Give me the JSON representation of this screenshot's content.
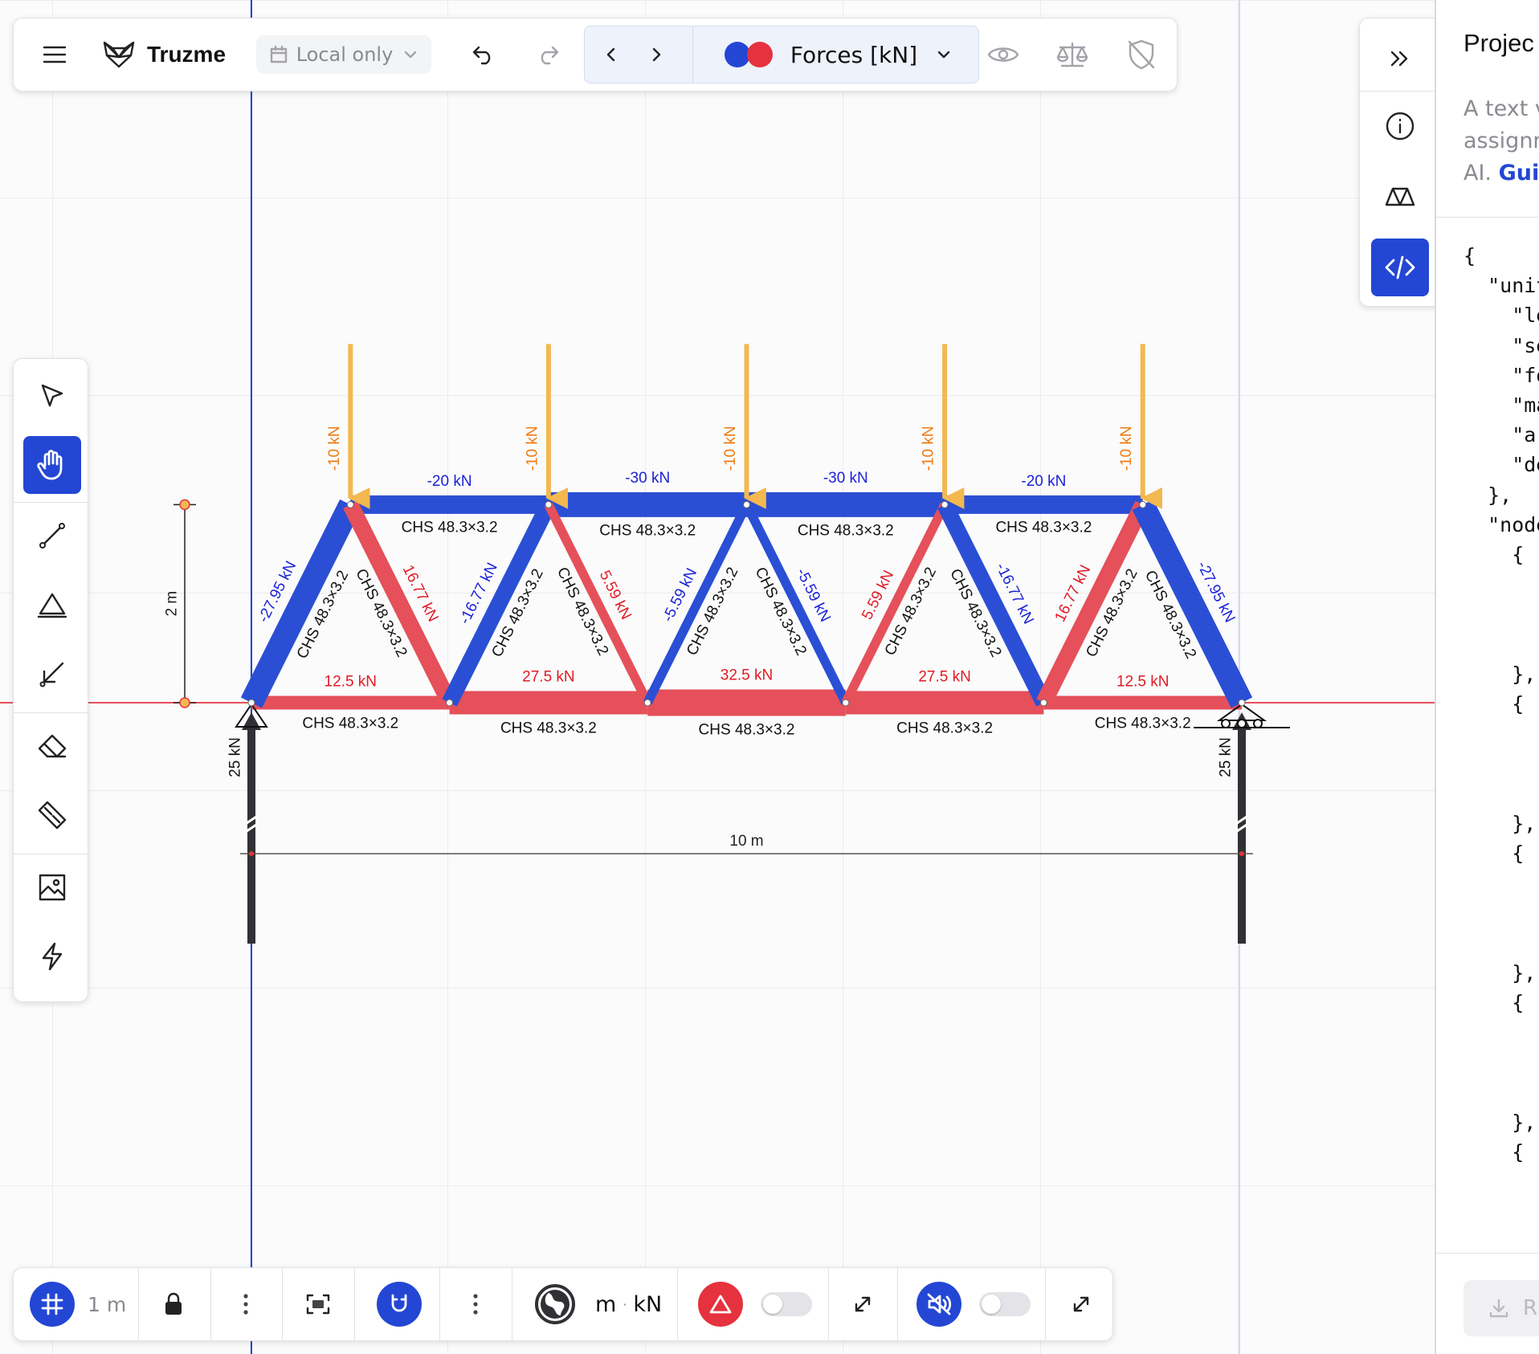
{
  "app": {
    "name": "Truzme",
    "storage_label": "Local only",
    "result_label": "Forces [kN]"
  },
  "colors": {
    "accent": "#2347d4",
    "tension": "#e5505a",
    "compression": "#2b4fd4",
    "load": "#f3b84f",
    "reaction": "#2f3135",
    "load_text": "#f07a10",
    "tension_text": "#e01b24",
    "compression_text": "#1c22d6"
  },
  "bottom_toolbar": {
    "grid_size": "1 m",
    "units_length": "m",
    "units_separator": "·",
    "units_force": "kN"
  },
  "truss": {
    "nodes": [
      {
        "id": "n1",
        "x": 0,
        "y": 0
      },
      {
        "id": "n2",
        "x": 2,
        "y": 0
      },
      {
        "id": "n3",
        "x": 4,
        "y": 0
      },
      {
        "id": "n4",
        "x": 6,
        "y": 0
      },
      {
        "id": "n5",
        "x": 8,
        "y": 0
      },
      {
        "id": "n6",
        "x": 10,
        "y": 0
      },
      {
        "id": "n7",
        "x": 1,
        "y": 2
      },
      {
        "id": "n8",
        "x": 3,
        "y": 2
      },
      {
        "id": "n9",
        "x": 5,
        "y": 2
      },
      {
        "id": "n10",
        "x": 7,
        "y": 2
      },
      {
        "id": "n11",
        "x": 9,
        "y": 2
      }
    ],
    "members": [
      {
        "from": "n1",
        "to": "n2",
        "force": 12.5,
        "label": "12.5 kN",
        "section": "CHS 48.3×3.2"
      },
      {
        "from": "n2",
        "to": "n3",
        "force": 27.5,
        "label": "27.5 kN",
        "section": "CHS 48.3×3.2"
      },
      {
        "from": "n3",
        "to": "n4",
        "force": 32.5,
        "label": "32.5 kN",
        "section": "CHS 48.3×3.2"
      },
      {
        "from": "n4",
        "to": "n5",
        "force": 27.5,
        "label": "27.5 kN",
        "section": "CHS 48.3×3.2"
      },
      {
        "from": "n5",
        "to": "n6",
        "force": 12.5,
        "label": "12.5 kN",
        "section": "CHS 48.3×3.2"
      },
      {
        "from": "n7",
        "to": "n8",
        "force": -20,
        "label": "-20 kN",
        "section": "CHS 48.3×3.2"
      },
      {
        "from": "n8",
        "to": "n9",
        "force": -30,
        "label": "-30 kN",
        "section": "CHS 48.3×3.2"
      },
      {
        "from": "n9",
        "to": "n10",
        "force": -30,
        "label": "-30 kN",
        "section": "CHS 48.3×3.2"
      },
      {
        "from": "n10",
        "to": "n11",
        "force": -20,
        "label": "-20 kN",
        "section": "CHS 48.3×3.2"
      },
      {
        "from": "n1",
        "to": "n7",
        "force": -27.95,
        "label": "-27.95 kN",
        "section": "CHS 48.3×3.2"
      },
      {
        "from": "n7",
        "to": "n2",
        "force": 16.77,
        "label": "16.77 kN",
        "section": "CHS 48.3×3.2"
      },
      {
        "from": "n2",
        "to": "n8",
        "force": -16.77,
        "label": "-16.77 kN",
        "section": "CHS 48.3×3.2"
      },
      {
        "from": "n8",
        "to": "n3",
        "force": 5.59,
        "label": "5.59 kN",
        "section": "CHS 48.3×3.2"
      },
      {
        "from": "n3",
        "to": "n9",
        "force": -5.59,
        "label": "-5.59 kN",
        "section": "CHS 48.3×3.2"
      },
      {
        "from": "n9",
        "to": "n4",
        "force": -5.59,
        "label": "-5.59 kN",
        "section": "CHS 48.3×3.2"
      },
      {
        "from": "n4",
        "to": "n10",
        "force": 5.59,
        "label": "5.59 kN",
        "section": "CHS 48.3×3.2"
      },
      {
        "from": "n10",
        "to": "n5",
        "force": -16.77,
        "label": "-16.77 kN",
        "section": "CHS 48.3×3.2"
      },
      {
        "from": "n5",
        "to": "n11",
        "force": 16.77,
        "label": "16.77 kN",
        "section": "CHS 48.3×3.2"
      },
      {
        "from": "n11",
        "to": "n6",
        "force": -27.95,
        "label": "-27.95 kN",
        "section": "CHS 48.3×3.2"
      }
    ],
    "loads": [
      {
        "node": "n7",
        "value": -10,
        "label": "-10 kN"
      },
      {
        "node": "n8",
        "value": -10,
        "label": "-10 kN"
      },
      {
        "node": "n9",
        "value": -10,
        "label": "-10 kN"
      },
      {
        "node": "n10",
        "value": -10,
        "label": "-10 kN"
      },
      {
        "node": "n11",
        "value": -10,
        "label": "-10 kN"
      }
    ],
    "supports": [
      {
        "node": "n1",
        "type": "pinned"
      },
      {
        "node": "n6",
        "type": "roller"
      }
    ],
    "reactions": [
      {
        "node": "n1",
        "value": 25,
        "label": "25 kN"
      },
      {
        "node": "n6",
        "value": 25,
        "label": "25 kN"
      }
    ],
    "dimensions": {
      "height_label": "2 m",
      "span_label": "10 m"
    }
  },
  "right_panel": {
    "title": "Projec",
    "desc_line1": "A text v",
    "desc_line2": "assignm",
    "desc_line3": "AI.",
    "desc_link": "Gui",
    "code_lines": [
      "{",
      "  \"unit",
      "    \"le",
      "    \"se",
      "    \"fo",
      "    \"ma",
      "    \"ar",
      "    \"de",
      "  },",
      "  \"node",
      "    {",
      "      \"",
      "      \"",
      "      \"",
      "    },",
      "    {",
      "      \"",
      "      \"",
      "      \"",
      "    },",
      "    {",
      "      \"",
      "      \"",
      "      \"",
      "    },",
      "    {",
      "      \"",
      "      \"",
      "      \"",
      "    },",
      "    {",
      "      \"",
      "      \"",
      "      \""
    ],
    "download_label": "R"
  }
}
